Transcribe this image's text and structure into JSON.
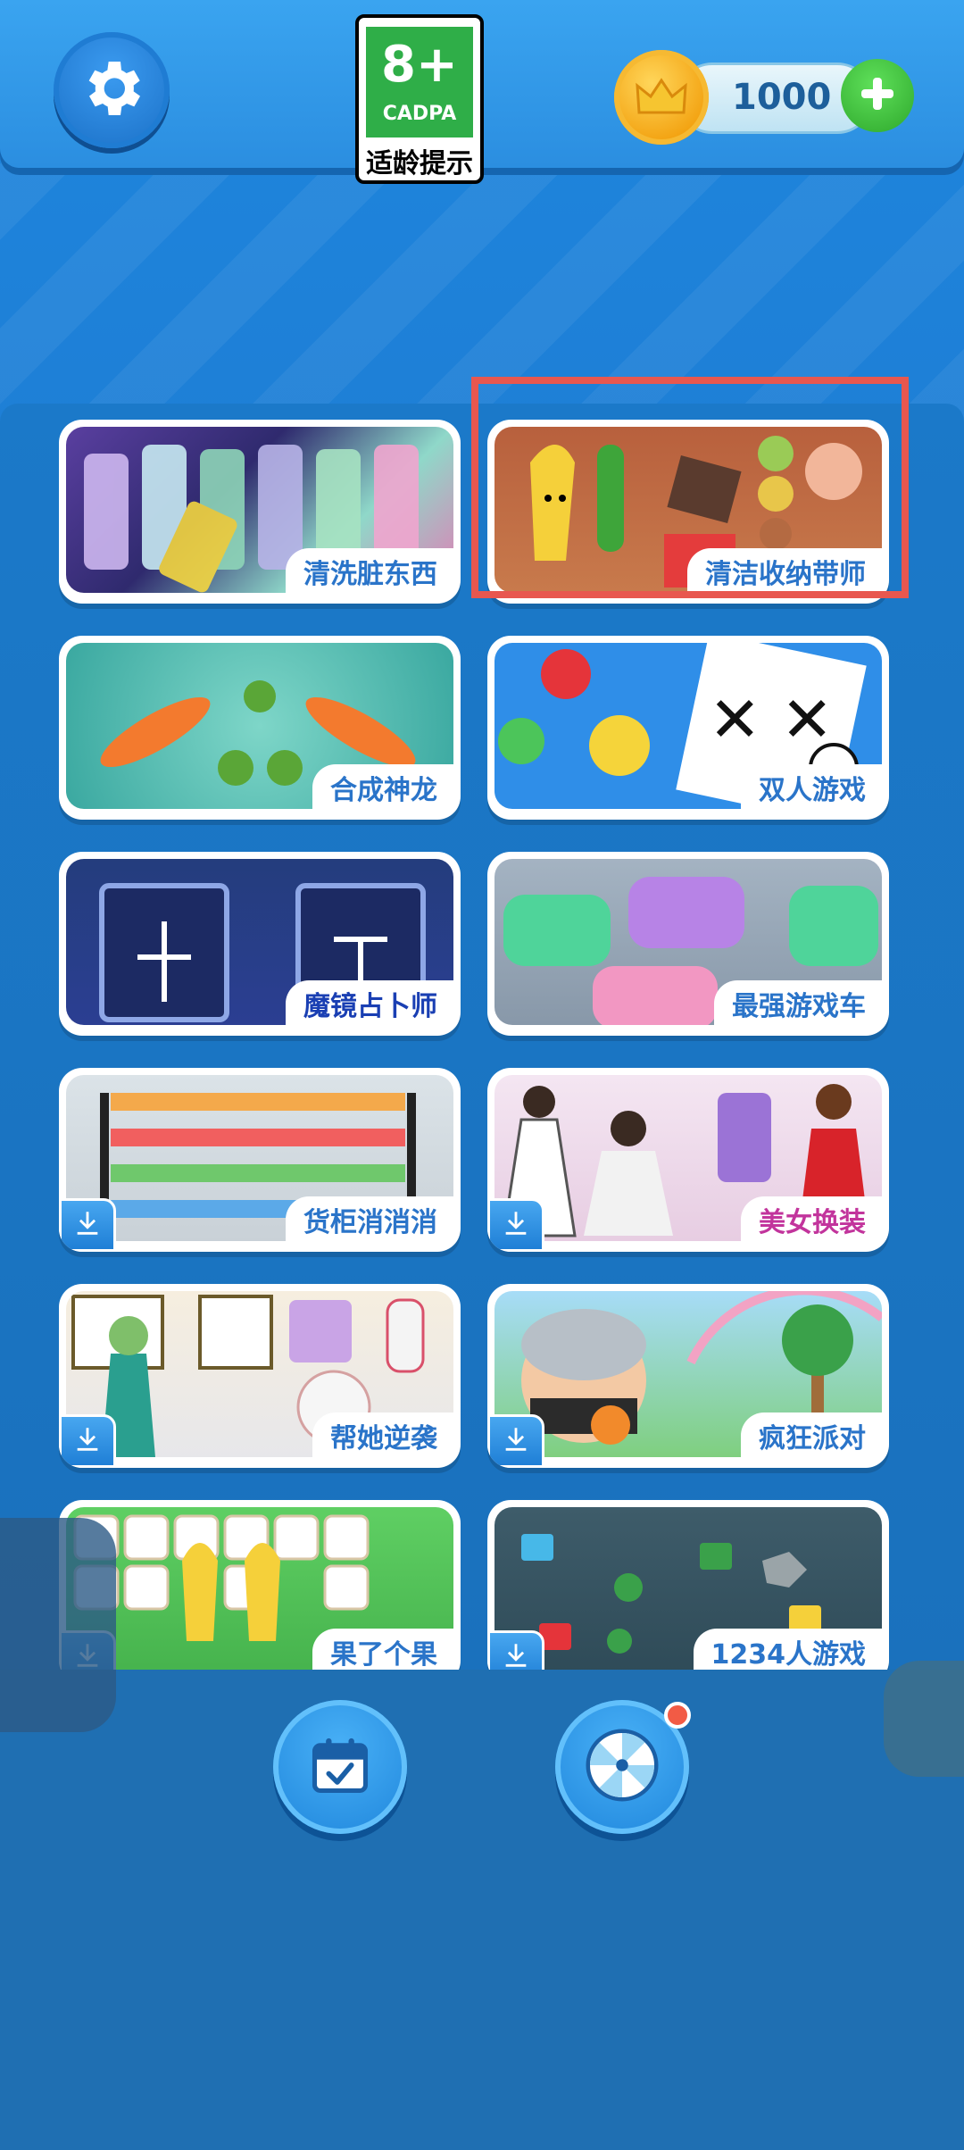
{
  "header": {
    "settings_icon": "gear-icon",
    "age_rating": {
      "number": "8+",
      "org": "CADPA",
      "label": "适龄提示"
    },
    "coins": {
      "amount": "1000",
      "coin_icon": "crown-coin-icon",
      "add_icon": "plus-icon"
    }
  },
  "games": [
    {
      "title": "清洗脏东西",
      "title_color": "#2a74c9",
      "download": false
    },
    {
      "title": "清洁收纳带师",
      "title_color": "#2a74c9",
      "download": false
    },
    {
      "title": "合成神龙",
      "title_color": "#2a74c9",
      "download": false
    },
    {
      "title": "双人游戏",
      "title_color": "#2a74c9",
      "download": false
    },
    {
      "title": "魔镜占卜师",
      "title_color": "#1a3fb3",
      "download": false
    },
    {
      "title": "最强游戏车",
      "title_color": "#2a74c9",
      "download": false
    },
    {
      "title": "货柜消消消",
      "title_color": "#2a74c9",
      "download": true
    },
    {
      "title": "美女换装",
      "title_color": "#c2349c",
      "download": true
    },
    {
      "title": "帮她逆袭",
      "title_color": "#2a74c9",
      "download": true
    },
    {
      "title": "疯狂派对",
      "title_color": "#2a74c9",
      "download": true
    },
    {
      "title": "果了个果",
      "title_color": "#2a74c9",
      "download": true
    },
    {
      "title": "1234人游戏",
      "title_color": "#2a74c9",
      "download": true
    }
  ],
  "bottom_nav": {
    "calendar_icon": "calendar-check-icon",
    "wheel_icon": "lucky-wheel-icon"
  }
}
